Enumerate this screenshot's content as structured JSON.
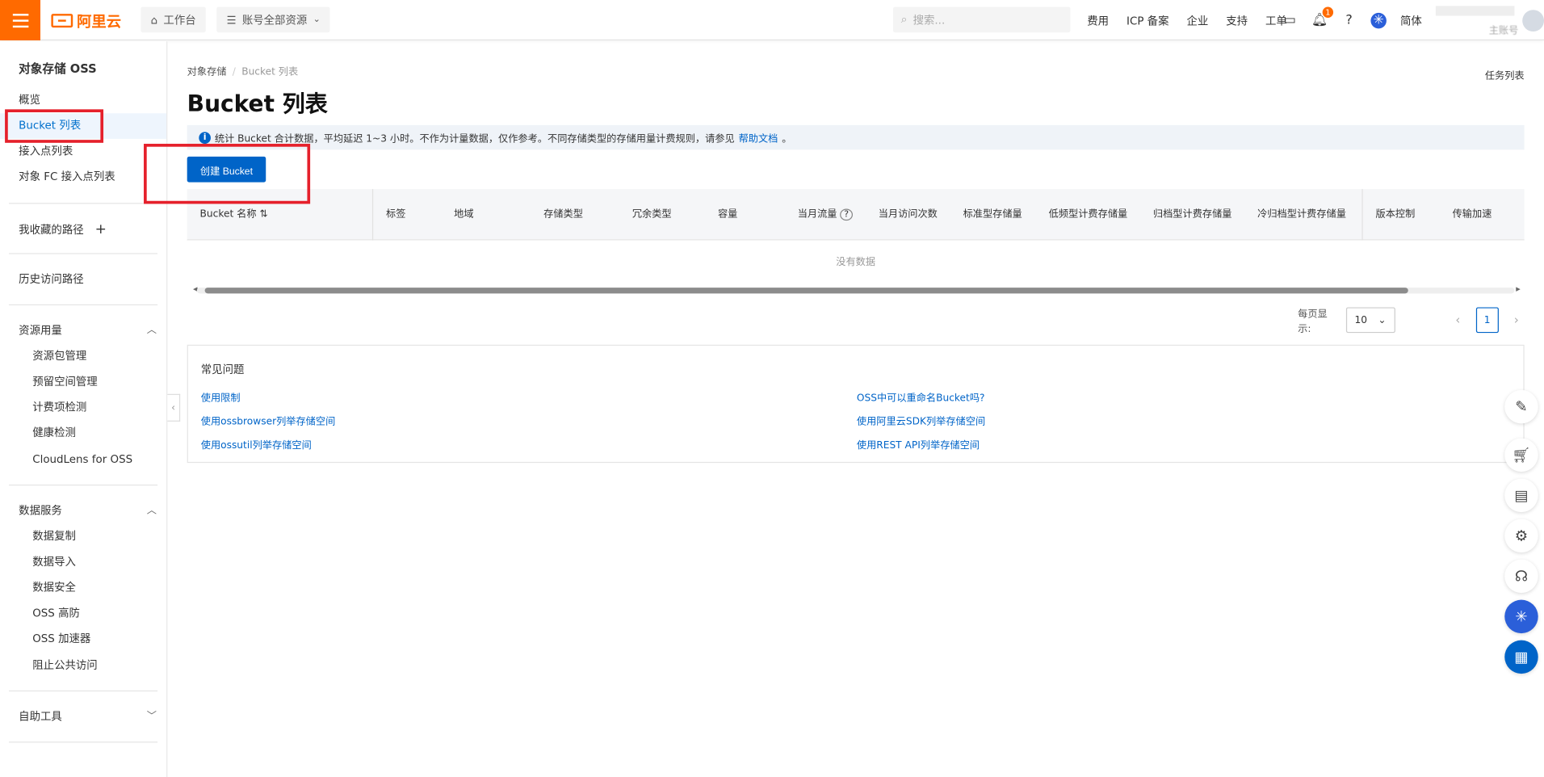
{
  "header": {
    "logo_text": "阿里云",
    "workbench_label": "工作台",
    "account_resources_label": "账号全部资源",
    "search_placeholder": "搜索...",
    "nav_links": [
      "费用",
      "ICP 备案",
      "企业",
      "支持",
      "工单"
    ],
    "notification_count": "1",
    "language_label": "简体",
    "account_label": "主账号"
  },
  "sidebar": {
    "title": "对象存储 OSS",
    "items": [
      "概览",
      "Bucket 列表",
      "接入点列表",
      "对象 FC 接入点列表"
    ],
    "favorites_label": "我收藏的路径",
    "history_label": "历史访问路径",
    "resource_usage": {
      "label": "资源用量",
      "items": [
        "资源包管理",
        "预留空间管理",
        "计费项检测",
        "健康检测",
        "CloudLens for OSS"
      ]
    },
    "data_services": {
      "label": "数据服务",
      "items": [
        "数据复制",
        "数据导入",
        "数据安全",
        "OSS 高防",
        "OSS 加速器",
        "阻止公共访问"
      ]
    },
    "self_help_label": "自助工具"
  },
  "main": {
    "breadcrumb": [
      "对象存储",
      "Bucket 列表"
    ],
    "task_list_label": "任务列表",
    "title": "Bucket 列表",
    "notice_text": "统计 Bucket 合计数据，平均延迟 1~3 小时。不作为计量数据，仅作参考。不同存储类型的存储用量计费规则，请参见",
    "notice_link": "帮助文档",
    "notice_end": "。",
    "create_button": "创建 Bucket",
    "table_columns": [
      "Bucket 名称",
      "标签",
      "地域",
      "存储类型",
      "冗余类型",
      "容量",
      "当月流量",
      "当月访问次数",
      "标准型存储量",
      "低频型计费存储量",
      "归档型计费存储量",
      "冷归档型计费存储量",
      "版本控制",
      "传输加速"
    ],
    "empty_text": "没有数据",
    "page_size_label": "每页显示:",
    "page_size_value": "10",
    "current_page": "1"
  },
  "faq": {
    "title": "常见问题",
    "links": [
      "使用限制",
      "使用ossbrowser列举存储空间",
      "使用ossutil列举存储空间",
      "OSS中可以重命名Bucket吗?",
      "使用阿里云SDK列举存储空间",
      "使用REST API列举存储空间"
    ]
  },
  "colors": {
    "brand_orange": "#ff6a00",
    "primary_blue": "#0064c8",
    "highlight_red": "#e5202b"
  },
  "icons": [
    "menu-icon",
    "home-icon",
    "resource-icon",
    "chevron-down-icon",
    "search-icon",
    "terminal-icon",
    "bell-icon",
    "help-icon",
    "assistant-icon",
    "plus-icon",
    "chevron-up-icon",
    "info-icon",
    "sort-icon",
    "question-icon",
    "edit-icon",
    "cart-icon",
    "document-icon",
    "settings-icon",
    "headset-icon",
    "apps-icon"
  ]
}
